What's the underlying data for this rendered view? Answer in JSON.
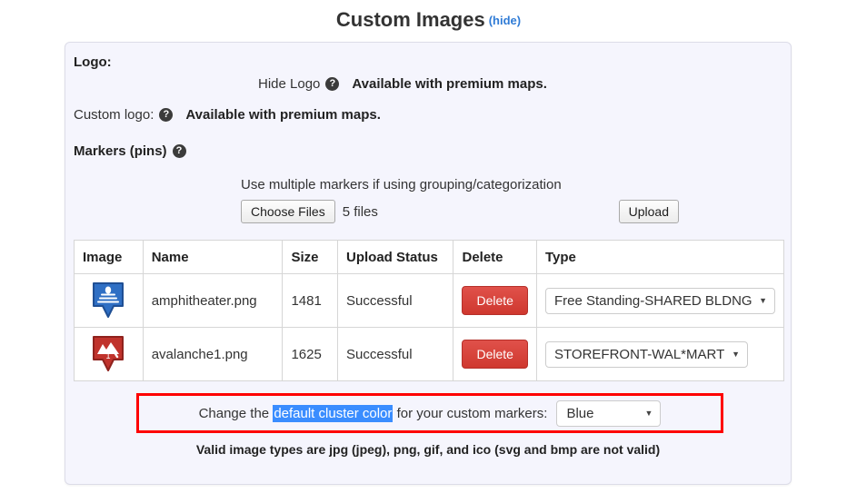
{
  "header": {
    "title": "Custom Images",
    "hide_link": "(hide)"
  },
  "panel": {
    "logo_label": "Logo:",
    "hide_logo_label": "Hide Logo",
    "hide_logo_help_icon": "question-mark-icon",
    "hide_logo_note": "Available with premium maps.",
    "custom_logo_label": "Custom logo:",
    "custom_logo_help_icon": "question-mark-icon",
    "custom_logo_note": "Available with premium maps.",
    "markers_label": "Markers (pins)",
    "markers_help_icon": "question-mark-icon",
    "multiple_markers_hint": "Use multiple markers if using grouping/categorization",
    "choose_files_label": "Choose Files",
    "file_count_label": "5 files",
    "upload_label": "Upload"
  },
  "table": {
    "columns": [
      "Image",
      "Name",
      "Size",
      "Upload Status",
      "Delete",
      "Type"
    ],
    "rows": [
      {
        "image_icon": "blue-amphitheater-pin-icon",
        "name": "amphitheater.png",
        "size": "1481",
        "status": "Successful",
        "delete_label": "Delete",
        "type_value": "Free Standing-SHARED BLDNG"
      },
      {
        "image_icon": "red-avalanche-pin-icon",
        "name": "avalanche1.png",
        "size": "1625",
        "status": "Successful",
        "delete_label": "Delete",
        "type_value": "STOREFRONT-WAL*MART"
      }
    ]
  },
  "cluster": {
    "text_before": "Change the",
    "highlighted_text": "default cluster color",
    "text_after": "for your custom markers:",
    "color_value": "Blue",
    "highlight_border_color": "#fe0000",
    "selection_color": "#3a8dff"
  },
  "footer": {
    "valid_types_note": "Valid image types are jpg (jpeg), png, gif, and ico (svg and bmp are not valid)"
  }
}
